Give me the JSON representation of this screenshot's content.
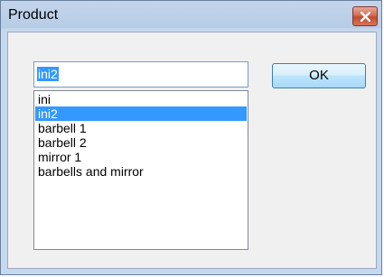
{
  "dialog": {
    "title": "Product",
    "close_icon": "close-icon"
  },
  "combo": {
    "value": "ini2"
  },
  "list": {
    "items": [
      {
        "label": "ini",
        "selected": false
      },
      {
        "label": "ini2",
        "selected": true
      },
      {
        "label": "barbell 1",
        "selected": false
      },
      {
        "label": "barbell 2",
        "selected": false
      },
      {
        "label": "mirror 1",
        "selected": false
      },
      {
        "label": "barbells and mirror",
        "selected": false
      }
    ]
  },
  "buttons": {
    "ok_label": "OK"
  },
  "colors": {
    "selection": "#3399ff",
    "close_button": "#c8523a"
  }
}
